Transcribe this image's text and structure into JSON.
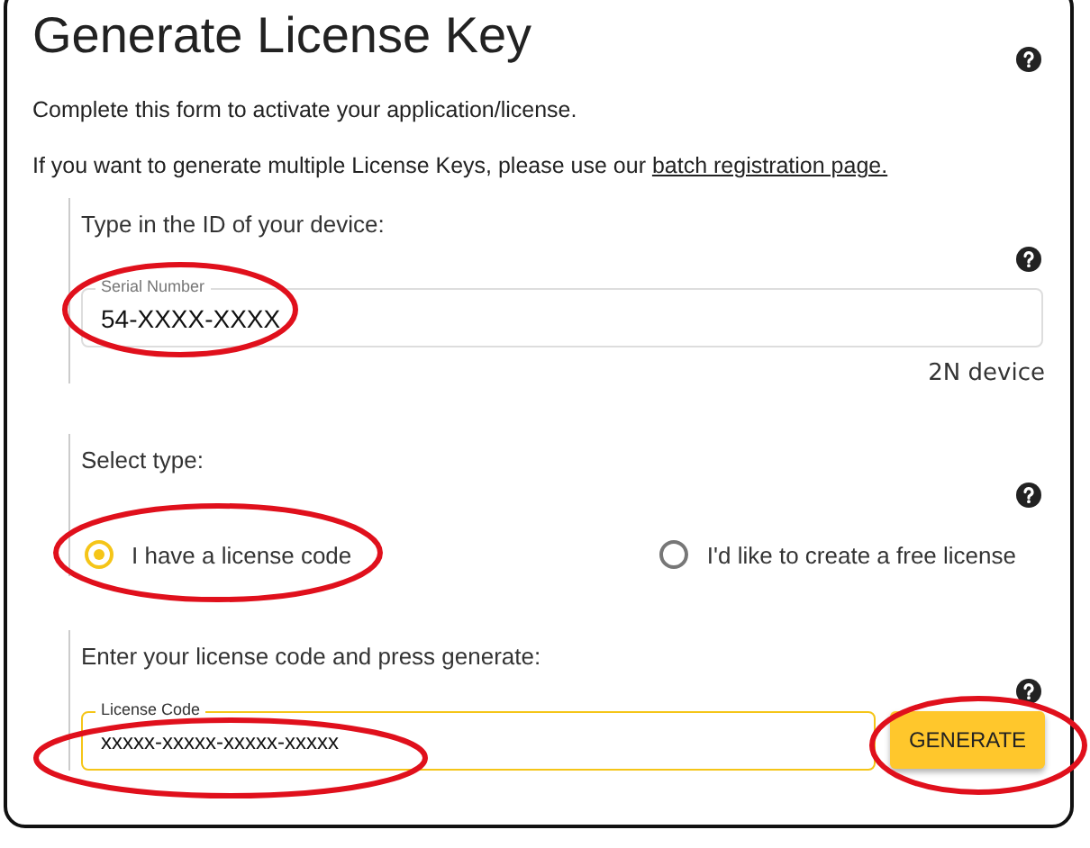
{
  "title": "Generate License Key",
  "intro": "Complete this form to activate your application/license.",
  "batch_note": {
    "text": "If you want to generate multiple License Keys, please use our ",
    "link": "batch registration page."
  },
  "device_section": {
    "label": "Type in the ID of your device:",
    "field": {
      "label": "Serial Number",
      "value": "54-XXXX-XXXX"
    },
    "hint": "2N device"
  },
  "type_section": {
    "label": "Select type:",
    "options": [
      {
        "label": "I have a license code",
        "selected": true
      },
      {
        "label": "I'd like to create a free license",
        "selected": false
      }
    ]
  },
  "code_section": {
    "label": "Enter your license code and press generate:",
    "field": {
      "label": "License Code",
      "value": "xxxxx-xxxxx-xxxxx-xxxxx",
      "focused": true
    },
    "button": "GENERATE"
  }
}
